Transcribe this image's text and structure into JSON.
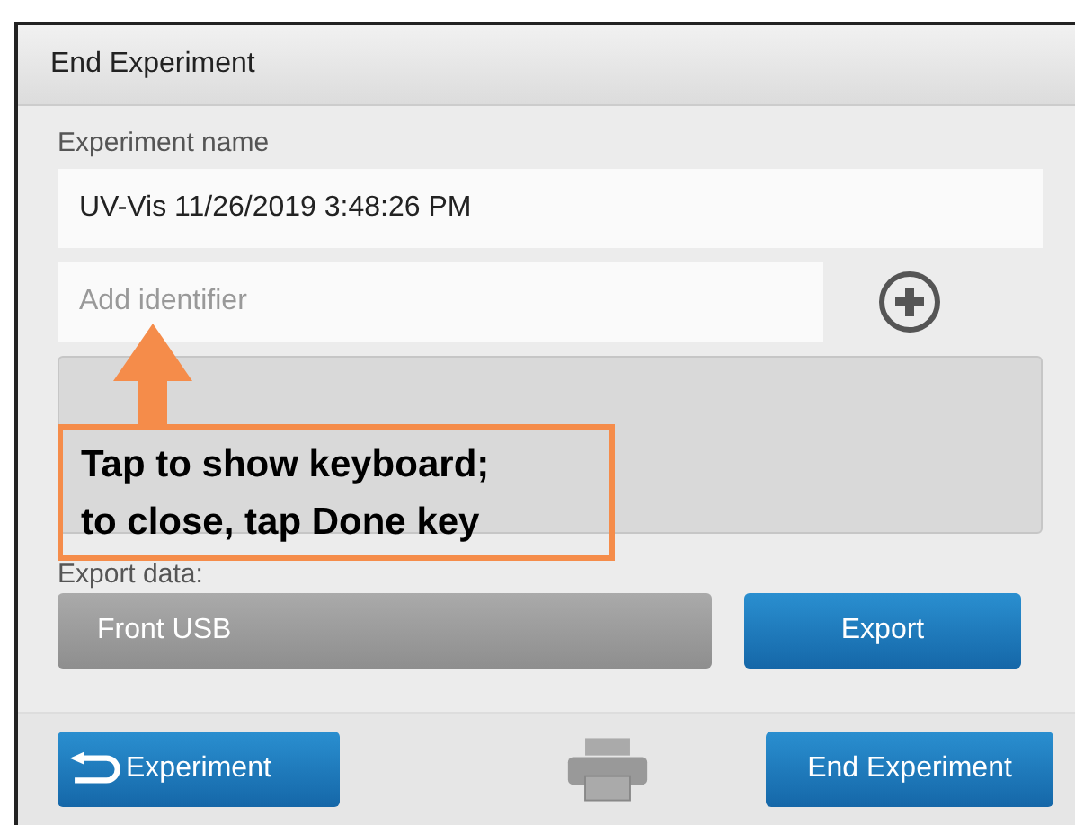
{
  "dialog": {
    "title": "End Experiment"
  },
  "name_field": {
    "label": "Experiment name",
    "value": "UV-Vis 11/26/2019 3:48:26 PM"
  },
  "identifier_field": {
    "placeholder": "Add identifier"
  },
  "export": {
    "label": "Export data:",
    "destination": "Front USB",
    "button": "Export"
  },
  "footer": {
    "back_button": "Experiment",
    "end_button": "End Experiment"
  },
  "annotation": {
    "text": "Tap to show keyboard;\nto close, tap Done key"
  }
}
